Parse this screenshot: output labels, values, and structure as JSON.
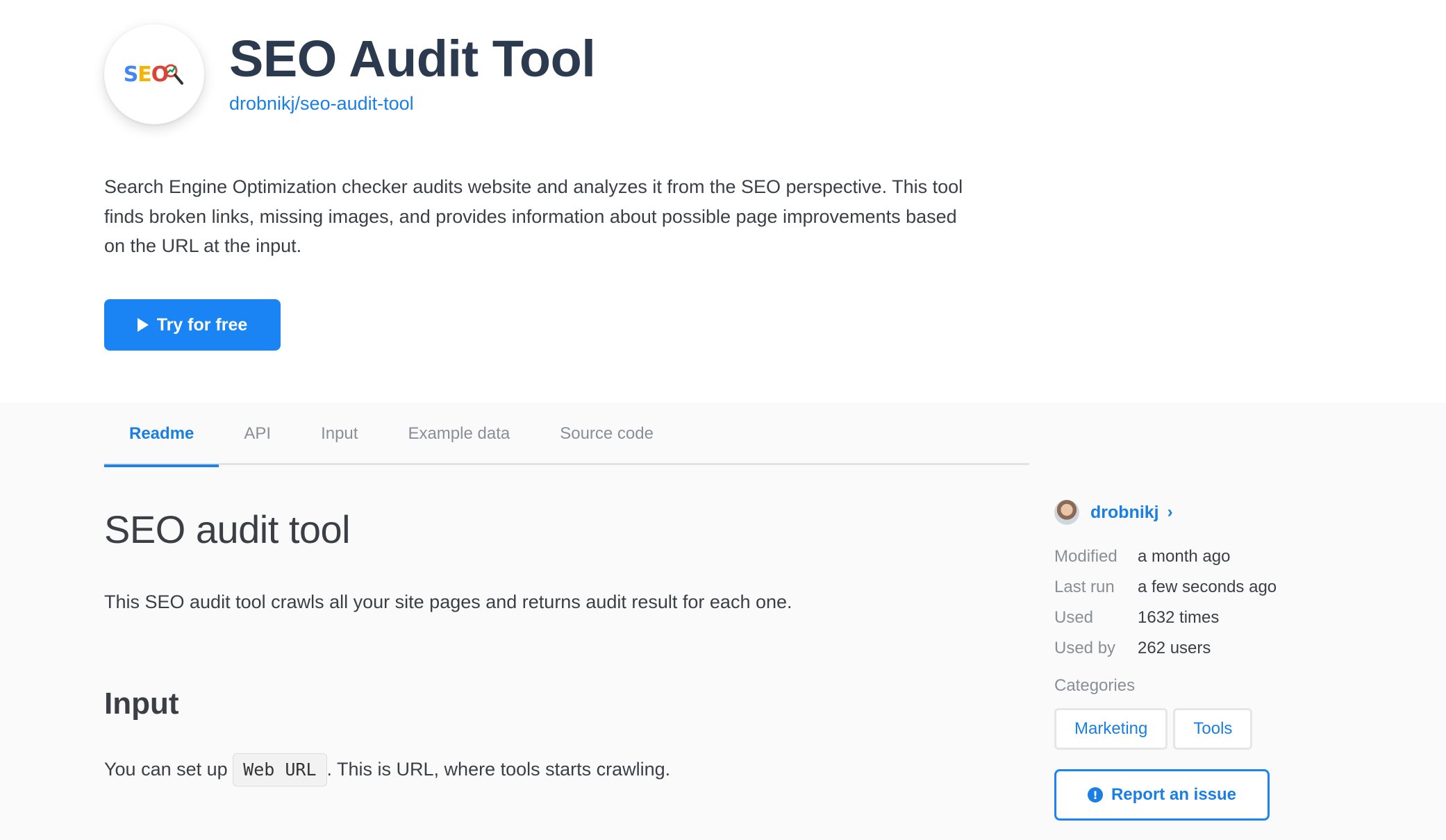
{
  "header": {
    "logo": {
      "letters": [
        "S",
        "E",
        "O"
      ],
      "icon": "magnifier-chart-icon"
    },
    "title": "SEO Audit Tool",
    "repo": "drobnikj/seo-audit-tool",
    "description": "Search Engine Optimization checker audits website and analyzes it from the SEO perspective. This tool finds broken links, missing images, and provides information about possible page improvements based on the URL at the input.",
    "try_button": "Try for free"
  },
  "tabs": [
    {
      "label": "Readme",
      "active": true
    },
    {
      "label": "API",
      "active": false
    },
    {
      "label": "Input",
      "active": false
    },
    {
      "label": "Example data",
      "active": false
    },
    {
      "label": "Source code",
      "active": false
    }
  ],
  "readme": {
    "heading": "SEO audit tool",
    "intro": "This SEO audit tool crawls all your site pages and returns audit result for each one.",
    "input_heading": "Input",
    "input_text_before": "You can set up ",
    "input_code": "Web URL",
    "input_text_after": ". This is URL, where tools starts crawling."
  },
  "sidebar": {
    "author": "drobnikj",
    "meta": [
      {
        "key": "Modified",
        "value": "a month ago"
      },
      {
        "key": "Last run",
        "value": "a few seconds ago"
      },
      {
        "key": "Used",
        "value": "1632 times"
      },
      {
        "key": "Used by",
        "value": "262 users"
      }
    ],
    "categories_label": "Categories",
    "categories": [
      "Marketing",
      "Tools"
    ],
    "report_button": "Report an issue"
  },
  "colors": {
    "accent": "#1a84f4",
    "title": "#2b3a4f",
    "text": "#3b3f45",
    "muted": "#8a8f95",
    "lower_bg": "#fafafa"
  }
}
